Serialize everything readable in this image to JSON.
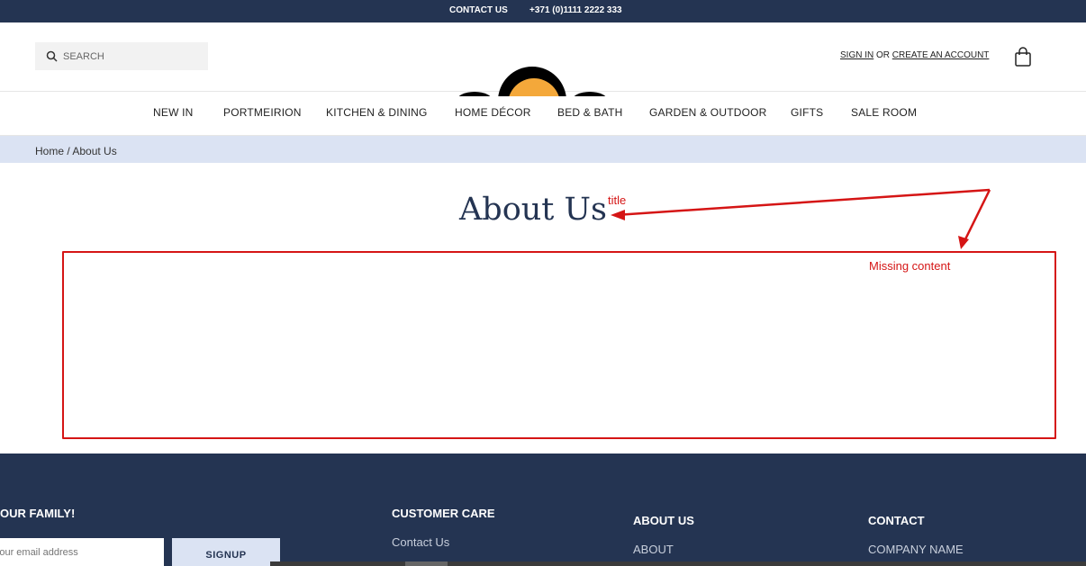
{
  "topbar": {
    "contact": "CONTACT US",
    "phone": "+371 (0)1111 2222 333"
  },
  "header": {
    "search_placeholder": "SEARCH",
    "sign_in": "SIGN IN",
    "or": "OR",
    "create_account": "CREATE AN ACCOUNT"
  },
  "nav": {
    "items": [
      "NEW IN",
      "PORTMEIRION",
      "KITCHEN & DINING",
      "HOME DÉCOR",
      "BED & BATH",
      "GARDEN & OUTDOOR",
      "GIFTS",
      "SALE ROOM"
    ]
  },
  "breadcrumb": "Home / About Us",
  "page": {
    "title": "About Us"
  },
  "annotations": {
    "title_label": "title",
    "missing_label": "Missing content"
  },
  "footer": {
    "newsletter_heading": "OUR FAMILY!",
    "email_placeholder": "Your email address",
    "signup": "SIGNUP",
    "customer_care": {
      "heading": "CUSTOMER CARE",
      "links": [
        "Contact Us"
      ]
    },
    "about": {
      "heading": "ABOUT US",
      "links": [
        "ABOUT"
      ]
    },
    "contact": {
      "heading": "CONTACT",
      "links": [
        "COMPANY NAME"
      ]
    }
  },
  "colors": {
    "navy": "#243452",
    "light_blue": "#dbe3f3",
    "annotation_red": "#d51515",
    "logo_orange": "#f4a83a"
  }
}
